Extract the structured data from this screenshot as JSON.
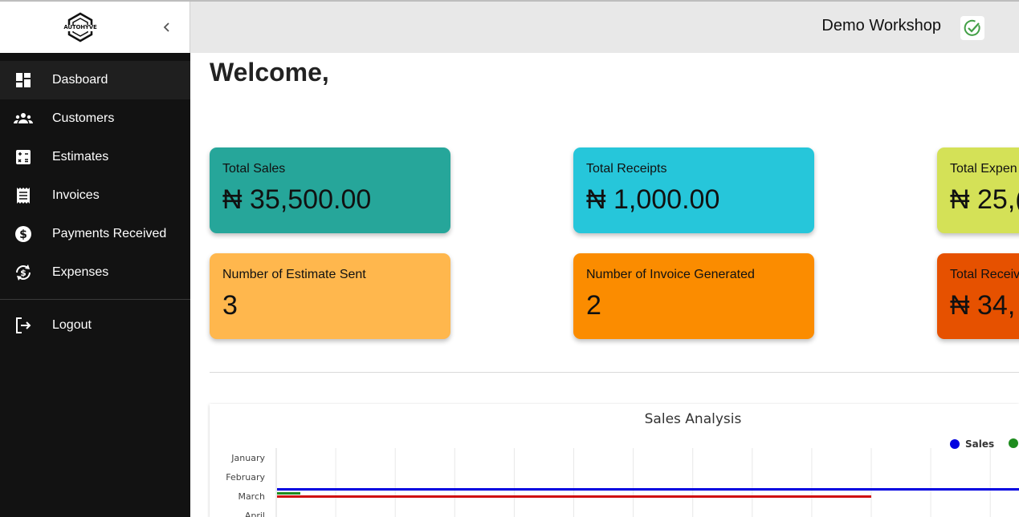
{
  "brand": {
    "logo_text": "AUTOHYVE"
  },
  "sidebar": {
    "items": [
      {
        "label": "Dasboard",
        "icon": "dashboard-icon"
      },
      {
        "label": "Customers",
        "icon": "customers-icon"
      },
      {
        "label": "Estimates",
        "icon": "calculator-icon"
      },
      {
        "label": "Invoices",
        "icon": "receipt-icon"
      },
      {
        "label": "Payments Received",
        "icon": "dollar-icon"
      },
      {
        "label": "Expenses",
        "icon": "money-exchange-icon"
      }
    ],
    "logout": {
      "label": "Logout",
      "icon": "logout-icon"
    }
  },
  "header": {
    "workshop_name": "Demo Workshop"
  },
  "main": {
    "welcome": "Welcome,",
    "cards": [
      {
        "title": "Total Sales",
        "value": "₦ 35,500.00",
        "color": "#26a69a"
      },
      {
        "title": "Total Receipts",
        "value": "₦ 1,000.00",
        "color": "#26c6da"
      },
      {
        "title": "Total Expen",
        "value": "₦ 25,(",
        "color": "#d4e157"
      },
      {
        "title": "Number of Estimate Sent",
        "value": "3",
        "color": "#ffb74d"
      },
      {
        "title": "Number of Invoice Generated",
        "value": "2",
        "color": "#fb8c00"
      },
      {
        "title": "Total Receiv",
        "value": "₦ 34,",
        "color": "#e65100"
      }
    ]
  },
  "chart_data": {
    "type": "bar",
    "title": "Sales Analysis",
    "orientation": "horizontal",
    "categories": [
      "January",
      "February",
      "March",
      "April"
    ],
    "legend_position": "top-right",
    "grid": true,
    "series": [
      {
        "name": "Sales",
        "color": "#0000e0"
      },
      {
        "name": "",
        "color": "#1e8c1e"
      },
      {
        "name": "",
        "color": "#d01010"
      }
    ],
    "notes_visible": "values cut off; March shows bars only"
  }
}
